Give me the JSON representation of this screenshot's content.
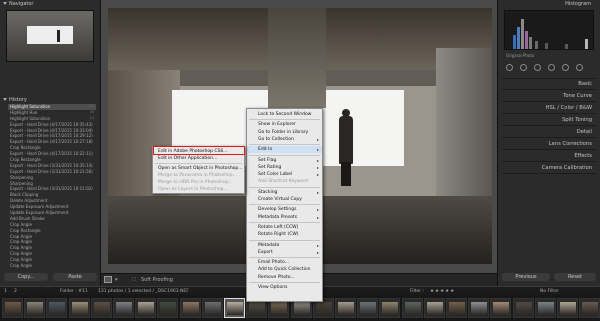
{
  "left_panel": {
    "navigator_title": "Navigator",
    "history_title": "History",
    "history_items": [
      {
        "label": "Highlight Saturation",
        "num": "-22"
      },
      {
        "label": "Highlight Hue",
        "num": "18"
      },
      {
        "label": "Highlight Saturation",
        "num": "14"
      },
      {
        "label": "Export - Hard Drive (4/17/2015 10:35:43)",
        "num": ""
      },
      {
        "label": "Export - Hard Drive (4/17/2015 10:33:04)",
        "num": ""
      },
      {
        "label": "Export - Hard Drive (4/17/2015 10:29:12)",
        "num": ""
      },
      {
        "label": "Export - Hard Drive (4/17/2015 10:27:18)",
        "num": ""
      },
      {
        "label": "Crop Rectangle",
        "num": ""
      },
      {
        "label": "Export - Hard Drive (4/17/2015 10:22:11)",
        "num": ""
      },
      {
        "label": "Crop Rectangle",
        "num": ""
      },
      {
        "label": "Export - Hard Drive (3/31/2015 10:35:14)",
        "num": ""
      },
      {
        "label": "Export - Hard Drive (3/31/2015 10:21:56)",
        "num": ""
      },
      {
        "label": "Sharpening",
        "num": ""
      },
      {
        "label": "Sharpening",
        "num": ""
      },
      {
        "label": "Export - Hard Drive (3/31/2015 10:11:02)",
        "num": ""
      },
      {
        "label": "Black Clipping",
        "num": ""
      },
      {
        "label": "Delete Adjustment",
        "num": ""
      },
      {
        "label": "Update Exposure Adjustment",
        "num": ""
      },
      {
        "label": "Update Exposure Adjustment",
        "num": ""
      },
      {
        "label": "Add Brush Stroke",
        "num": ""
      },
      {
        "label": "Crop Angle",
        "num": ""
      },
      {
        "label": "Crop Rectangle",
        "num": ""
      },
      {
        "label": "Crop Angle",
        "num": ""
      },
      {
        "label": "Crop Angle",
        "num": ""
      },
      {
        "label": "Crop Angle",
        "num": ""
      },
      {
        "label": "Crop Angle",
        "num": ""
      },
      {
        "label": "Crop Angle",
        "num": ""
      },
      {
        "label": "Crop Angle",
        "num": ""
      }
    ],
    "copy_label": "Copy...",
    "paste_label": "Paste"
  },
  "right_panel": {
    "histogram_title": "Histogram",
    "original_photo_label": "Original Photo",
    "sections": [
      {
        "label": "Basic"
      },
      {
        "label": "Tone Curve"
      },
      {
        "label": "HSL / Color / B&W"
      },
      {
        "label": "Split Toning"
      },
      {
        "label": "Detail"
      },
      {
        "label": "Lens Corrections"
      },
      {
        "label": "Effects"
      },
      {
        "label": "Camera Calibration"
      }
    ],
    "previous_label": "Previous",
    "reset_label": "Reset"
  },
  "toolbar": {
    "soft_proofing_label": "Soft Proofing"
  },
  "filmstrip_bar": {
    "page_1": "1",
    "page_2": "2",
    "folder_text": "Folder : #11",
    "count_text": "131 photos / 1 selected / _DSC1963.NEF",
    "filter_label": "Filter :",
    "no_filter_label": "No Filter"
  },
  "context_menu": {
    "items": [
      {
        "label": "Lock to Second Window",
        "dis": false,
        "arrow": false
      },
      {
        "label": "Show in Explorer",
        "dis": false,
        "arrow": false
      },
      {
        "label": "Go to Folder in Library",
        "dis": false,
        "arrow": false
      },
      {
        "label": "Go to Collection",
        "dis": false,
        "arrow": true
      },
      {
        "label": "Edit In",
        "dis": false,
        "arrow": true
      },
      {
        "label": "Set Flag",
        "dis": false,
        "arrow": true
      },
      {
        "label": "Set Rating",
        "dis": false,
        "arrow": true
      },
      {
        "label": "Set Color Label",
        "dis": false,
        "arrow": true
      },
      {
        "label": "Add Shortcut Keyword",
        "dis": true,
        "arrow": false
      },
      {
        "label": "Stacking",
        "dis": false,
        "arrow": true
      },
      {
        "label": "Create Virtual Copy",
        "dis": false,
        "arrow": false
      },
      {
        "label": "Develop Settings",
        "dis": false,
        "arrow": true
      },
      {
        "label": "Metadata Presets",
        "dis": false,
        "arrow": true
      },
      {
        "label": "Rotate Left (CCW)",
        "dis": false,
        "arrow": false
      },
      {
        "label": "Rotate Right (CW)",
        "dis": false,
        "arrow": false
      },
      {
        "label": "Metadata",
        "dis": false,
        "arrow": true
      },
      {
        "label": "Export",
        "dis": false,
        "arrow": true
      },
      {
        "label": "Email Photo...",
        "dis": false,
        "arrow": false
      },
      {
        "label": "Add to Quick Collection",
        "dis": false,
        "arrow": false
      },
      {
        "label": "Remove Photo...",
        "dis": false,
        "arrow": false
      },
      {
        "label": "View Options",
        "dis": false,
        "arrow": false
      }
    ]
  },
  "submenu": {
    "items": [
      {
        "label": "Edit in Adobe Photoshop CS6...",
        "dis": false
      },
      {
        "label": "Edit in Other Application...",
        "dis": false
      },
      {
        "label": "Open as Smart Object in Photoshop...",
        "dis": false
      },
      {
        "label": "Merge to Panorama in Photoshop...",
        "dis": true
      },
      {
        "label": "Merge to HDR Pro in Photoshop...",
        "dis": true
      },
      {
        "label": "Open as Layers in Photoshop...",
        "dis": true
      }
    ]
  },
  "colors": {
    "highlight_red": "#e0181c",
    "panel_bg": "#2b2b2b",
    "menu_bg": "#e9e9e9"
  }
}
